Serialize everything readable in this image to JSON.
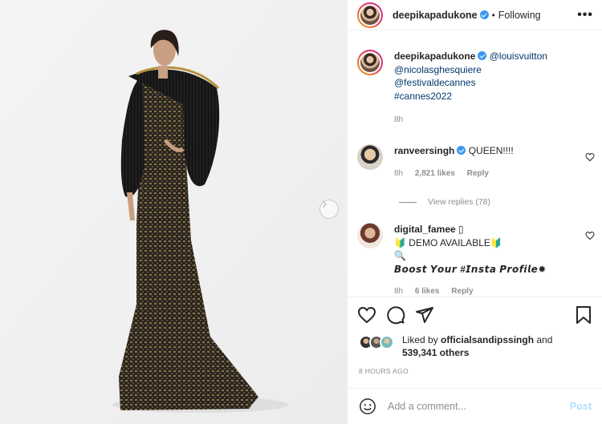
{
  "header": {
    "username": "deepikapadukone",
    "separator": "•",
    "follow_status": "Following",
    "more": "•••"
  },
  "caption": {
    "username": "deepikapadukone",
    "mention_1": "@louisvuitton",
    "mention_2": "@nicolasghesquiere",
    "mention_3": "@festivaldecannes",
    "hashtag": "#cannes2022",
    "time": "8h"
  },
  "comments": [
    {
      "username": "ranveersingh",
      "text": "QUEEN!!!!",
      "time": "8h",
      "likes": "2,821 likes",
      "reply": "Reply",
      "view_replies": "View replies (78)"
    },
    {
      "username": "digital_famee",
      "line1_suffix": "▯",
      "line2": "🔰 DEMO AVAILABLE🔰",
      "line3": "🔍",
      "line4": "𝘽𝙤𝙤𝙨𝙩 𝙔𝙤𝙪𝙧 #𝙄𝙣𝙨𝙩𝙖 𝙋𝙧𝙤𝙛𝙞𝙡𝙚✹",
      "time": "8h",
      "likes": "6 likes",
      "reply": "Reply"
    }
  ],
  "likes": {
    "prefix": "Liked by ",
    "user": "officialsandipssingh",
    "middle": " and",
    "count": "539,341 others"
  },
  "timestamp": "8 HOURS AGO",
  "add_comment": {
    "placeholder": "Add a comment...",
    "post_label": "Post"
  },
  "colors": {
    "verified": "#3897f0",
    "mention": "#00376b",
    "post_button": "#b2dffc"
  },
  "icons": [
    "next-arrow-icon",
    "verified-icon",
    "more-icon",
    "heart-icon",
    "comment-icon",
    "share-icon",
    "bookmark-icon",
    "emoji-icon"
  ]
}
